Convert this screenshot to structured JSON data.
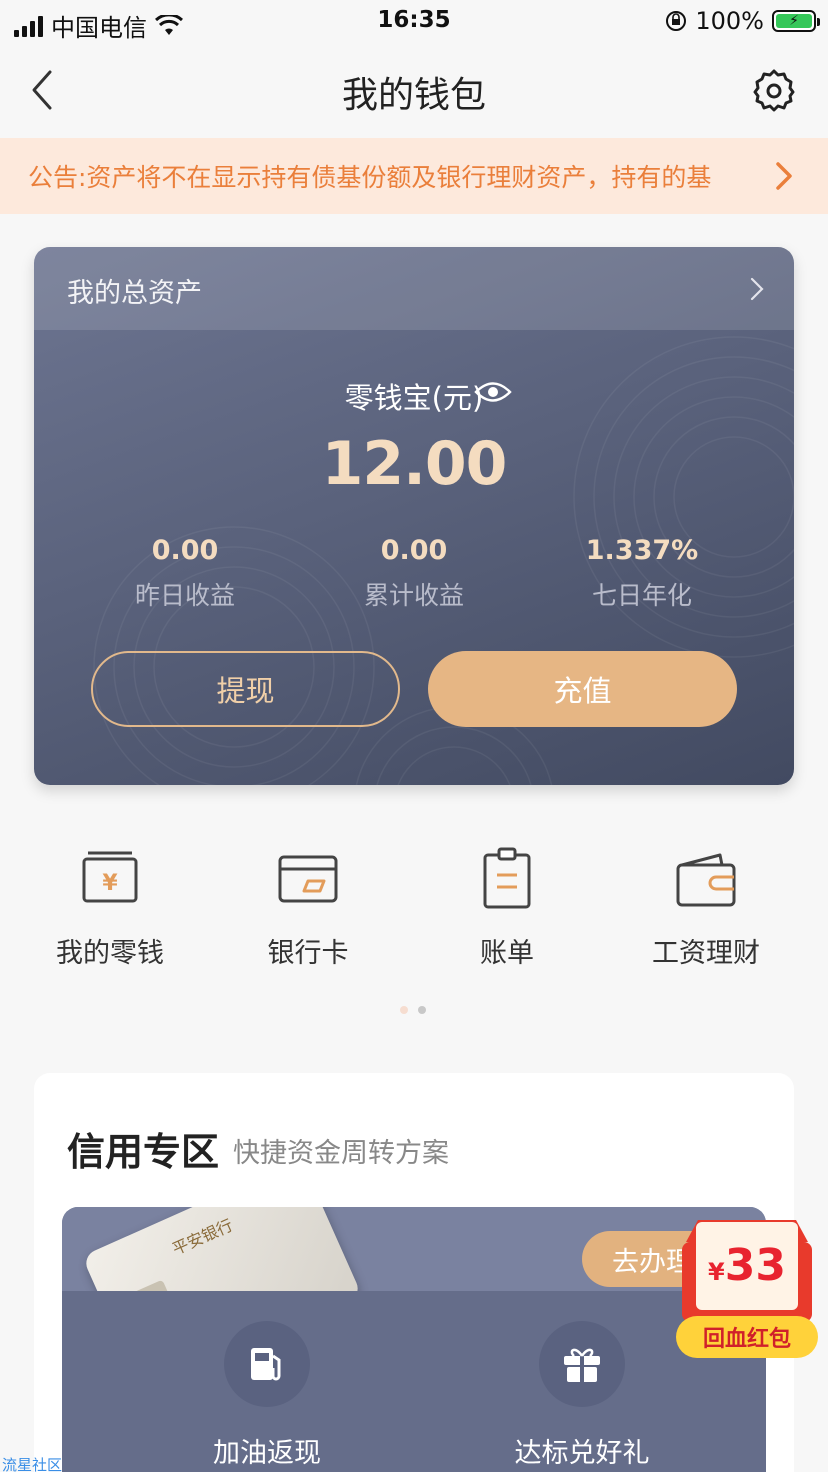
{
  "status_bar": {
    "carrier": "中国电信",
    "time": "16:35",
    "battery": "100%"
  },
  "nav": {
    "title": "我的钱包"
  },
  "notice": {
    "text": "公告:资产将不在显示持有债基份额及银行理财资产，持有的基"
  },
  "asset_card": {
    "title": "我的总资产",
    "product_label": "零钱宝(元)",
    "amount": "12.00",
    "stats": [
      {
        "value": "0.00",
        "label": "昨日收益"
      },
      {
        "value": "0.00",
        "label": "累计收益"
      },
      {
        "value": "1.337%",
        "label": "七日年化"
      }
    ],
    "withdraw_label": "提现",
    "recharge_label": "充值"
  },
  "quick_menu": {
    "items": [
      {
        "label": "我的零钱",
        "icon": "wallet-yen-icon"
      },
      {
        "label": "银行卡",
        "icon": "bank-card-icon"
      },
      {
        "label": "账单",
        "icon": "bill-clipboard-icon"
      },
      {
        "label": "工资理财",
        "icon": "salary-wallet-icon"
      }
    ],
    "page_count": 2,
    "active_page": 2
  },
  "credit_zone": {
    "title": "信用专区",
    "subtitle": "快捷资金周转方案",
    "card_bank_name": "平安银行",
    "go_button": "去办理",
    "features": [
      {
        "label": "加油返现",
        "icon": "fuel-pump-icon"
      },
      {
        "label": "达标兑好礼",
        "icon": "gift-icon"
      }
    ]
  },
  "red_packet": {
    "currency": "¥",
    "amount": "33",
    "label": "回血红包"
  },
  "watermark": "流星社区",
  "colors": {
    "accent_gold": "#e6b684",
    "notice_text": "#ea7f3b",
    "notice_bg": "#fde9dc",
    "card_bg": "#5a627c"
  }
}
